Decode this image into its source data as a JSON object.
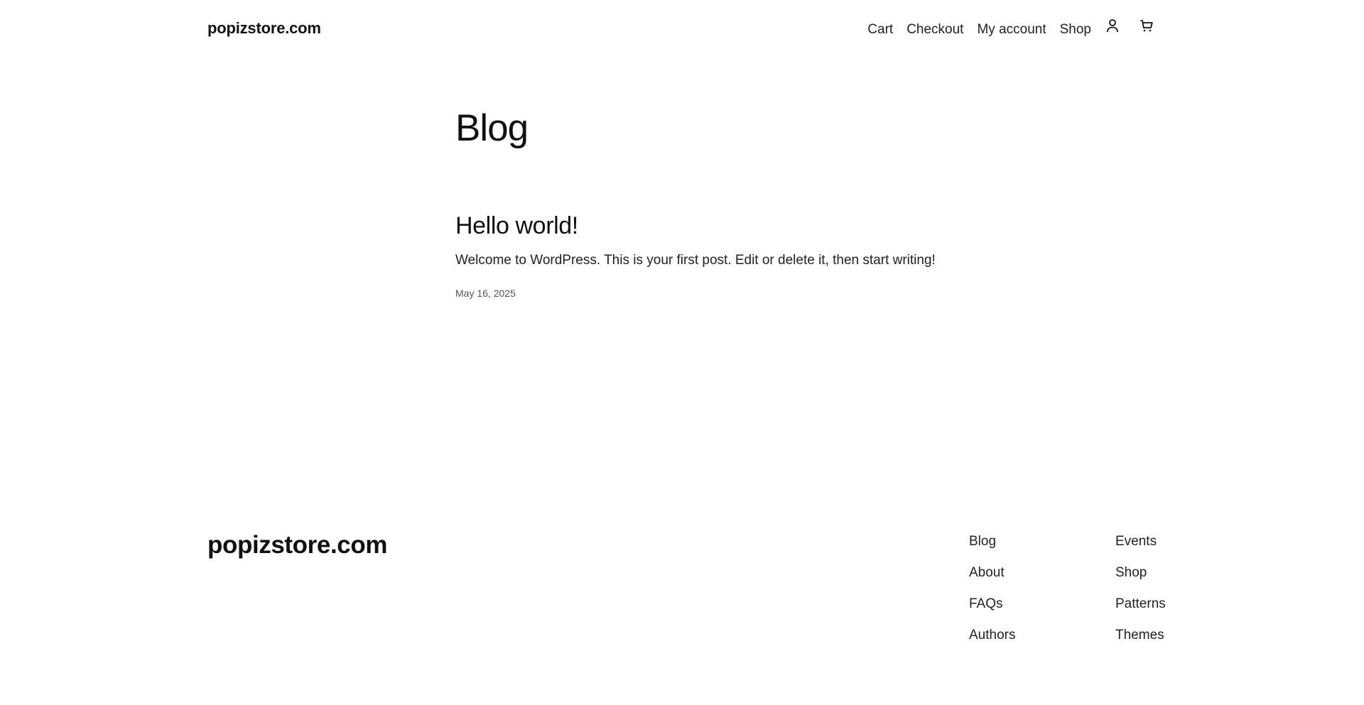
{
  "header": {
    "site_title": "popizstore.com",
    "nav": [
      "Cart",
      "Checkout",
      "My account",
      "Shop"
    ],
    "icons": [
      "account-icon",
      "cart-icon"
    ]
  },
  "main": {
    "page_title": "Blog",
    "posts": [
      {
        "title": "Hello world!",
        "excerpt": "Welcome to WordPress. This is your first post. Edit or delete it, then start writing!",
        "date": "May 16, 2025"
      }
    ]
  },
  "footer": {
    "site_title": "popizstore.com",
    "column_1": [
      "Blog",
      "About",
      "FAQs",
      "Authors"
    ],
    "column_2": [
      "Events",
      "Shop",
      "Patterns",
      "Themes"
    ]
  }
}
